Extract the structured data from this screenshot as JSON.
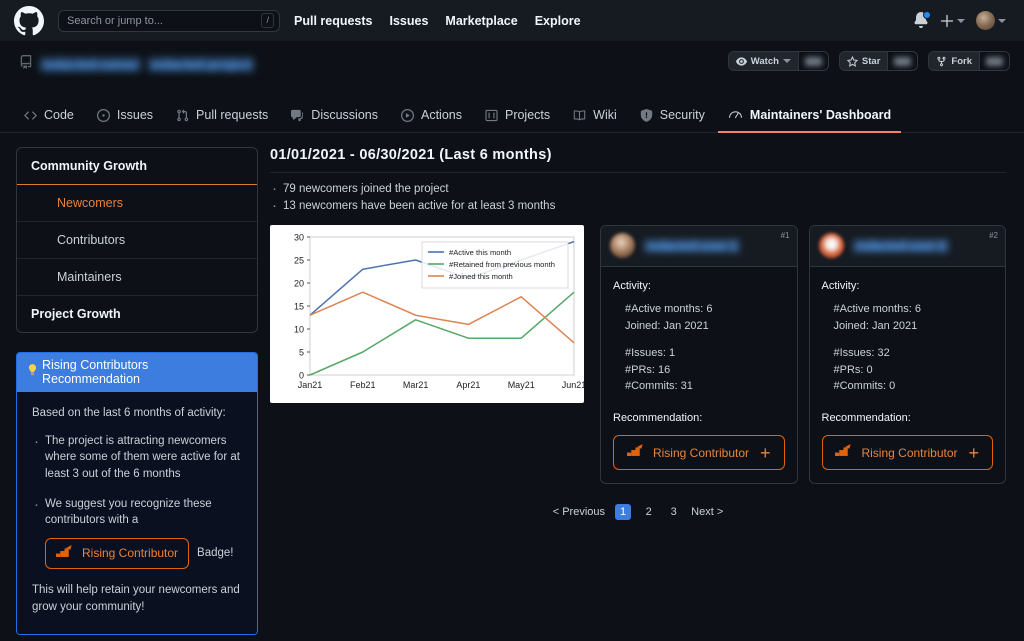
{
  "topbar": {
    "logo_icon": "github-logo-icon",
    "search": {
      "placeholder": "Search or jump to...",
      "shortcut": "/"
    },
    "nav": [
      {
        "label": "Pull requests"
      },
      {
        "label": "Issues"
      },
      {
        "label": "Marketplace"
      },
      {
        "label": "Explore"
      }
    ],
    "notifications_icon": "bell-icon",
    "create_new_icon": "plus-icon",
    "avatar_icon": "user-avatar"
  },
  "repo_header": {
    "repo_icon": "repository-icon",
    "owner": "redacted-owner",
    "separator": "/",
    "repo": "redacted-project",
    "actions": [
      {
        "label": "Watch",
        "icon": "eye-icon",
        "has_caret": true,
        "count": "redacted"
      },
      {
        "label": "Star",
        "icon": "star-icon",
        "has_caret": false,
        "count": "redacted"
      },
      {
        "label": "Fork",
        "icon": "fork-icon",
        "has_caret": false,
        "count": "redacted"
      }
    ]
  },
  "repo_tabs": [
    {
      "label": "Code",
      "icon": "code-icon",
      "active": false
    },
    {
      "label": "Issues",
      "icon": "issue-opened-icon",
      "active": false
    },
    {
      "label": "Pull requests",
      "icon": "git-pull-request-icon",
      "active": false
    },
    {
      "label": "Discussions",
      "icon": "comment-discussion-icon",
      "active": false
    },
    {
      "label": "Actions",
      "icon": "play-icon",
      "active": false
    },
    {
      "label": "Projects",
      "icon": "project-board-icon",
      "active": false
    },
    {
      "label": "Wiki",
      "icon": "book-icon",
      "active": false
    },
    {
      "label": "Security",
      "icon": "shield-icon",
      "active": false
    },
    {
      "label": "Maintainers' Dashboard",
      "icon": "graph-icon",
      "active": true
    }
  ],
  "sidebar": {
    "nav": [
      {
        "label": "Community Growth",
        "level": "head",
        "active": false
      },
      {
        "label": "Newcomers",
        "level": "sub",
        "active": true
      },
      {
        "label": "Contributors",
        "level": "sub",
        "active": false
      },
      {
        "label": "Maintainers",
        "level": "sub",
        "active": false
      },
      {
        "label": "Project Growth",
        "level": "foot",
        "active": false
      }
    ],
    "recommendation": {
      "icon": "lightbulb-icon",
      "title": "Rising Contributors Recommendation",
      "intro": "Based on the last 6 months of activity:",
      "bullet1": "The project is attracting newcomers where some of them were active for at least 3 out of the 6 months",
      "bullet2": "We suggest you recognize these contributors with a",
      "badge_label": "Rising Contributor",
      "badge_icon": "rising-stairs-icon",
      "badge_suffix": "Badge!",
      "footer": "This will help retain your newcomers and grow your community!"
    }
  },
  "main": {
    "date_range": "01/01/2021  -  06/30/2021  (Last 6 months)",
    "summary": [
      "79 newcomers joined the project",
      "13 newcomers have been active for at least 3 months"
    ],
    "contributors": [
      {
        "rank": "#1",
        "username": "redacted-user-1",
        "avatar_icon": "user-avatar",
        "activity_label": "Activity:",
        "active_months": "#Active months: 6",
        "joined": "Joined: Jan 2021",
        "issues": "#Issues: 1",
        "prs": "#PRs: 16",
        "commits": "#Commits: 31",
        "recommendation_label": "Recommendation:",
        "badge_label": "Rising Contributor",
        "badge_icon": "rising-stairs-icon",
        "badge_plus": "+"
      },
      {
        "rank": "#2",
        "username": "redacted-user-2",
        "avatar_icon": "user-avatar",
        "activity_label": "Activity:",
        "active_months": "#Active months: 6",
        "joined": "Joined: Jan 2021",
        "issues": "#Issues: 32",
        "prs": "#PRs: 0",
        "commits": "#Commits: 0",
        "recommendation_label": "Recommendation:",
        "badge_label": "Rising Contributor",
        "badge_icon": "rising-stairs-icon",
        "badge_plus": "+"
      }
    ],
    "pagination": {
      "previous": "< Previous",
      "pages": [
        "1",
        "2",
        "3"
      ],
      "current": "1",
      "next": "Next >"
    }
  },
  "chart_data": {
    "type": "line",
    "title": "",
    "xlabel": "",
    "ylabel": "",
    "x": [
      "Jan21",
      "Feb21",
      "Mar21",
      "Apr21",
      "May21",
      "Jun21"
    ],
    "ylim": [
      0,
      30
    ],
    "yticks": [
      0,
      5,
      10,
      15,
      20,
      25,
      30
    ],
    "grid": false,
    "legend_position": "upper right",
    "series": [
      {
        "name": "#Active this month",
        "color": "#4c72b0",
        "values": [
          13,
          23,
          25,
          21,
          25,
          29
        ]
      },
      {
        "name": "#Retained from previous month",
        "color": "#55a868",
        "values": [
          0,
          5,
          12,
          8,
          8,
          18
        ]
      },
      {
        "name": "#Joined this month",
        "color": "#dd8452",
        "values": [
          13,
          18,
          13,
          11,
          17,
          7
        ]
      }
    ]
  }
}
